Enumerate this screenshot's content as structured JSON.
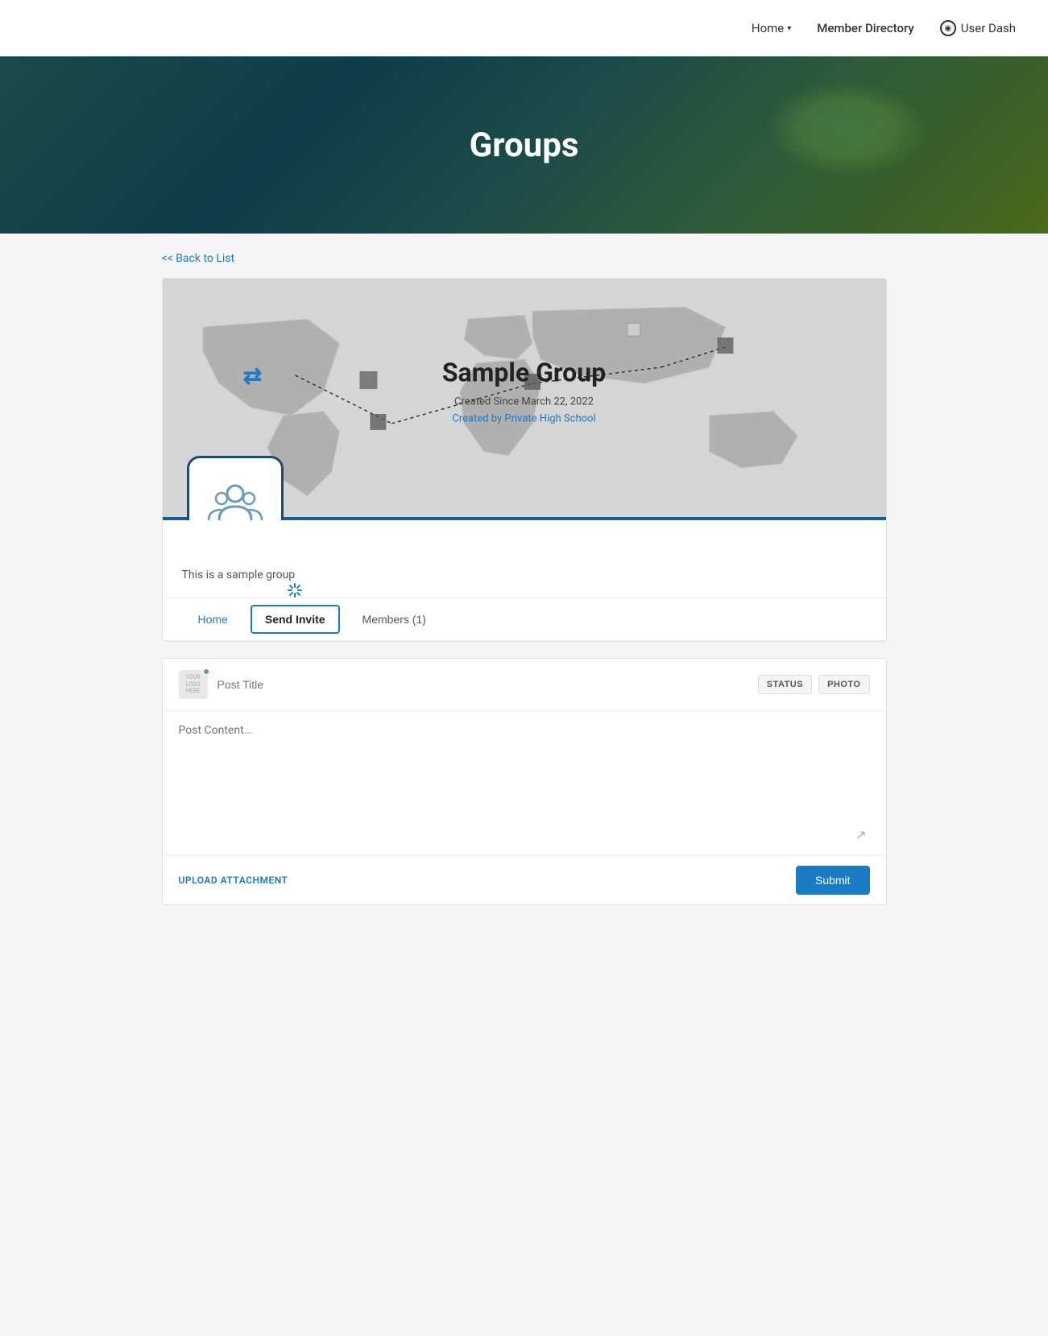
{
  "nav": {
    "home_label": "Home",
    "member_directory_label": "Member Directory",
    "user_dashboard_label": "User Dash"
  },
  "hero": {
    "title": "Groups"
  },
  "back_link": "<< Back to List",
  "group": {
    "name": "Sample Group",
    "created_since": "Created Since March 22, 2022",
    "created_by_prefix": "Created by",
    "created_by": "Private High School",
    "description": "This is a sample group",
    "logo_alt": "Group logo placeholder"
  },
  "tabs": {
    "home_label": "Home",
    "send_invite_label": "Send Invite",
    "members_label": "Members (1)"
  },
  "post": {
    "title_placeholder": "Post Title",
    "status_btn": "STATUS",
    "photo_btn": "PHOTO",
    "content_placeholder": "Post Content...",
    "upload_label": "UPLOAD ATTACHMENT",
    "submit_label": "Submit"
  },
  "avatar": {
    "text": "YOUR\nLOGO\nHERE"
  }
}
